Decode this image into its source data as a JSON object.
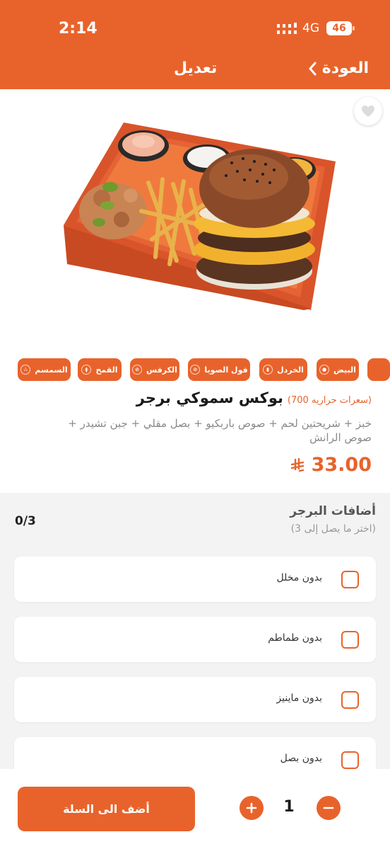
{
  "status": {
    "time": "2:14",
    "network": "4G",
    "battery": "46"
  },
  "nav": {
    "title": "تعديل",
    "back_label": "العودة"
  },
  "product": {
    "name": "بوكس سموكي برجر",
    "calories": "(سعرات حراريه 700)",
    "description": "خبز + شريحتين لحم + صوص باربكيو + بصل مقلي + جبن تشيدر + صوص الرانش",
    "price": "33.00",
    "currency_icon": "riyal-icon"
  },
  "allergens": [
    {
      "label": "البيض",
      "icon": "egg-icon"
    },
    {
      "label": "الخردل",
      "icon": "mustard-icon"
    },
    {
      "label": "فول الصويا",
      "icon": "soy-icon"
    },
    {
      "label": "الكرفس",
      "icon": "celery-icon"
    },
    {
      "label": "القمح",
      "icon": "wheat-icon"
    },
    {
      "label": "السمسم",
      "icon": "sesame-icon"
    }
  ],
  "addons": {
    "title": "أضافات البرجر",
    "subtitle": "(اختر ما يصل إلى 3)",
    "count": "0/3",
    "options": [
      {
        "label": "بدون مخلل"
      },
      {
        "label": "بدون طماطم"
      },
      {
        "label": "بدون ماينيز"
      },
      {
        "label": "بدون بصل"
      }
    ]
  },
  "cart": {
    "add_label": "أضف الى السلة",
    "quantity": "1"
  },
  "colors": {
    "accent": "#E8632B",
    "background": "#F3F3F3"
  }
}
